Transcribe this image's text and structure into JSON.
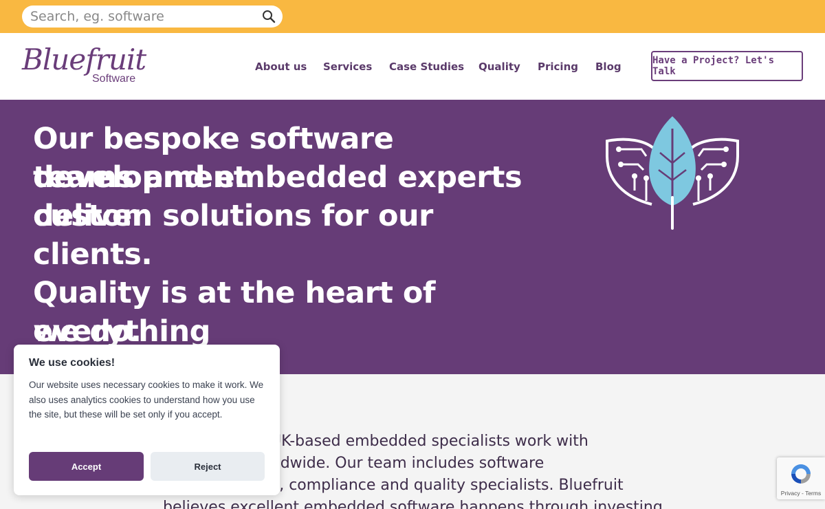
{
  "search": {
    "placeholder": "Search, eg. software"
  },
  "logo": {
    "script": "Bluefruit",
    "sub": "Software"
  },
  "nav": [
    {
      "label": "About us"
    },
    {
      "label": "Services"
    },
    {
      "label": "Case Studies"
    },
    {
      "label": "Quality"
    },
    {
      "label": "Pricing"
    },
    {
      "label": "Blog"
    }
  ],
  "cta": {
    "label": "Have a Project? Let's Talk"
  },
  "hero": {
    "line1": "Our bespoke software development",
    "line2": "teams and embedded experts deliver",
    "line3": "custom solutions for our clients.",
    "line4": "Quality is at the heart of everything",
    "line5": "we do."
  },
  "content": {
    "line1": "are’s UK-based embedded specialists work with",
    "line2": "ts worldwide. Our team includes software",
    "line3": "ers, UX, compliance and quality specialists. Bluefruit",
    "line4": "believes excellent embedded software happens through investing"
  },
  "cookie": {
    "title": "We use cookies!",
    "text": "Our website uses necessary cookies to make it work. We also uses analytics cookies to understand how you use the site, but these will be set only if you accept.",
    "accept": "Accept",
    "reject": "Reject"
  },
  "recaptcha": {
    "links": "Privacy - Terms"
  },
  "colors": {
    "topbar": "#f9b841",
    "brand_purple": "#663c77",
    "leaf_blue": "#7ec8e0"
  }
}
